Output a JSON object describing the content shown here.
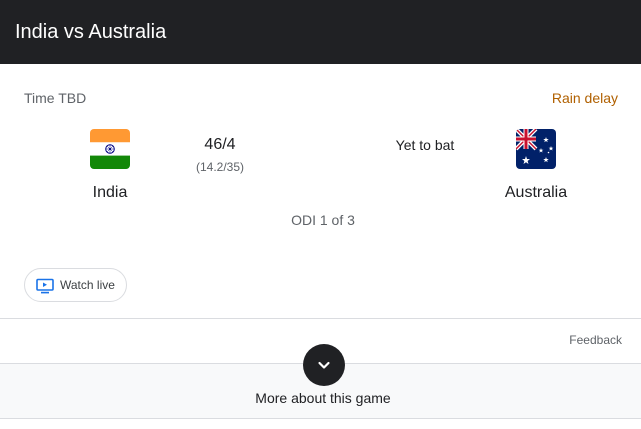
{
  "header": {
    "title": "India vs Australia"
  },
  "match": {
    "time": "Time TBD",
    "status": "Rain delay",
    "status_color": "#b06000",
    "series": "ODI 1 of 3",
    "home": {
      "name": "India",
      "score": "46/4",
      "overs": "(14.2/35)",
      "flag_icon": "india-flag-icon"
    },
    "away": {
      "name": "Australia",
      "score_text": "Yet to bat",
      "flag_icon": "australia-flag-icon"
    }
  },
  "actions": {
    "watch_live": "Watch live",
    "watch_icon": "live-tv-icon",
    "feedback": "Feedback",
    "more": "More about this game",
    "more_icon": "chevron-down-icon"
  }
}
